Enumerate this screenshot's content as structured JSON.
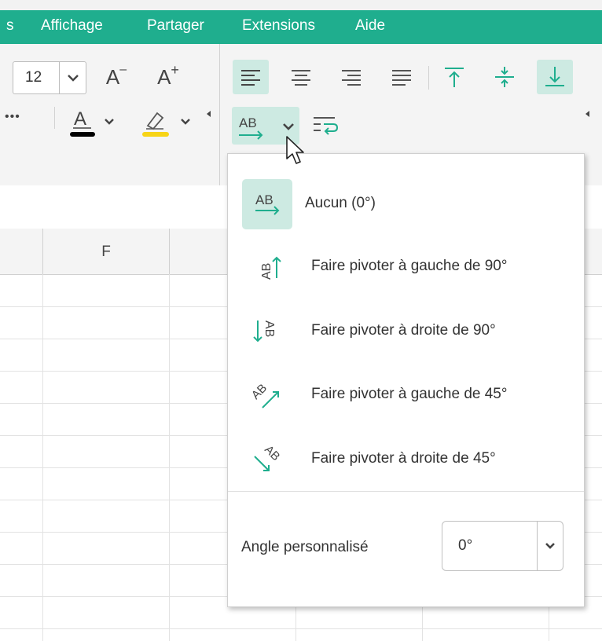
{
  "menubar": {
    "items": [
      "s",
      "Affichage",
      "Partager",
      "Extensions",
      "Aide"
    ]
  },
  "toolbar": {
    "font_size": "12",
    "decrease_font": "A",
    "increase_font": "A",
    "more": "•••",
    "accent_color": "#1fae8e",
    "font_color": "#000000",
    "highlight_color": "#f7d417"
  },
  "sheet": {
    "columns": [
      "",
      "F",
      "",
      "",
      "",
      ""
    ]
  },
  "rotation_menu": {
    "options": [
      {
        "label": "Aucun (0°)",
        "icon": "text-no-rotation-icon",
        "selected": true
      },
      {
        "label": "Faire pivoter à gauche de 90°",
        "icon": "rotate-left-90-icon",
        "selected": false
      },
      {
        "label": "Faire pivoter à droite de 90°",
        "icon": "rotate-right-90-icon",
        "selected": false
      },
      {
        "label": "Faire pivoter à gauche de 45°",
        "icon": "rotate-left-45-icon",
        "selected": false
      },
      {
        "label": "Faire pivoter à droite de 45°",
        "icon": "rotate-right-45-icon",
        "selected": false
      }
    ],
    "custom_angle_label": "Angle personnalisé",
    "custom_angle_value": "0°"
  }
}
